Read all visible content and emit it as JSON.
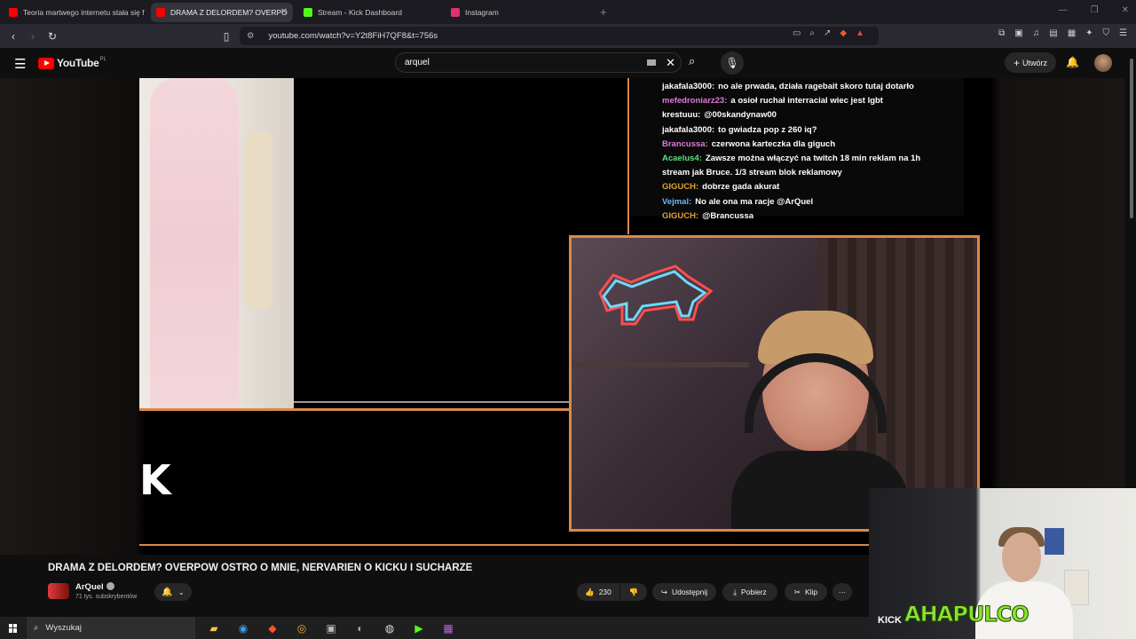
{
  "browser": {
    "tabs": [
      {
        "label": "Teoria martwego internetu stała się f",
        "favicon_color": "#ff0000",
        "active": false
      },
      {
        "label": "DRAMA Z DELORDEM? OVERPO",
        "favicon_color": "#ff0000",
        "active": true
      },
      {
        "label": "Stream - Kick Dashboard",
        "favicon_color": "#53fc18",
        "active": false
      },
      {
        "label": "Instagram",
        "favicon_color": "#e1306c",
        "active": false
      }
    ],
    "new_tab_symbol": "+",
    "close_symbol": "✕",
    "url": "youtube.com/watch?v=Y2t8FiH7QF8&t=756s"
  },
  "youtube": {
    "logo_text": "YouTube",
    "country_code": "PL",
    "search_value": "arquel",
    "create_label": "Utwórz",
    "video_title": "DRAMA Z DELORDEM? OVERPOW OSTRO O MNIE, NERVARIEN O KICKU I SUCHARZE",
    "channel_name": "ArQuel",
    "subscribers": "71 tys. subskrybentów",
    "likes": "230",
    "share_label": "Udostępnij",
    "download_label": "Pobierz",
    "clip_label": "Klip",
    "more_symbol": "···"
  },
  "stream_overlay": {
    "kick_logo_letter": "K",
    "chat": [
      {
        "user": "jakafala3000:",
        "user_color": "#ffffff",
        "message": "no ale prwada, działa ragebait skoro tutaj dotarło"
      },
      {
        "user": "mefedroniarz23:",
        "user_color": "#e07ad8",
        "message": "a osioł ruchał interracial wiec jest lgbt"
      },
      {
        "user": "krestuuu:",
        "user_color": "#ffffff",
        "message": "@00skandynaw00"
      },
      {
        "user": "jakafala3000:",
        "user_color": "#ffffff",
        "message": "to gwiadza pop z 260 iq?"
      },
      {
        "user": "Brancussa:",
        "user_color": "#e07ad8",
        "message": "czerwona karteczka dla giguch"
      },
      {
        "user": "Acaelus4:",
        "user_color": "#5be27a",
        "message": "Zawsze można włączyć na twitch 18 min reklam na 1h"
      },
      {
        "user": "",
        "user_color": "#ffffff",
        "message": "stream jak Bruce. 1/3 stream blok reklamowy"
      },
      {
        "user": "GIGUCH:",
        "user_color": "#e0a33a",
        "message": "dobrze gada akurat"
      },
      {
        "user": "Vejmal:",
        "user_color": "#6fb6ff",
        "message": "No ale ona ma racje @ArQuel"
      },
      {
        "user": "GIGUCH:",
        "user_color": "#e0a33a",
        "message": "@Brancussa"
      }
    ],
    "border_color": "#d9894a"
  },
  "facecam": {
    "overlay_text": "AHAPULCO",
    "kick_text": "KICK"
  },
  "taskbar": {
    "search_label": "Wyszukaj"
  }
}
